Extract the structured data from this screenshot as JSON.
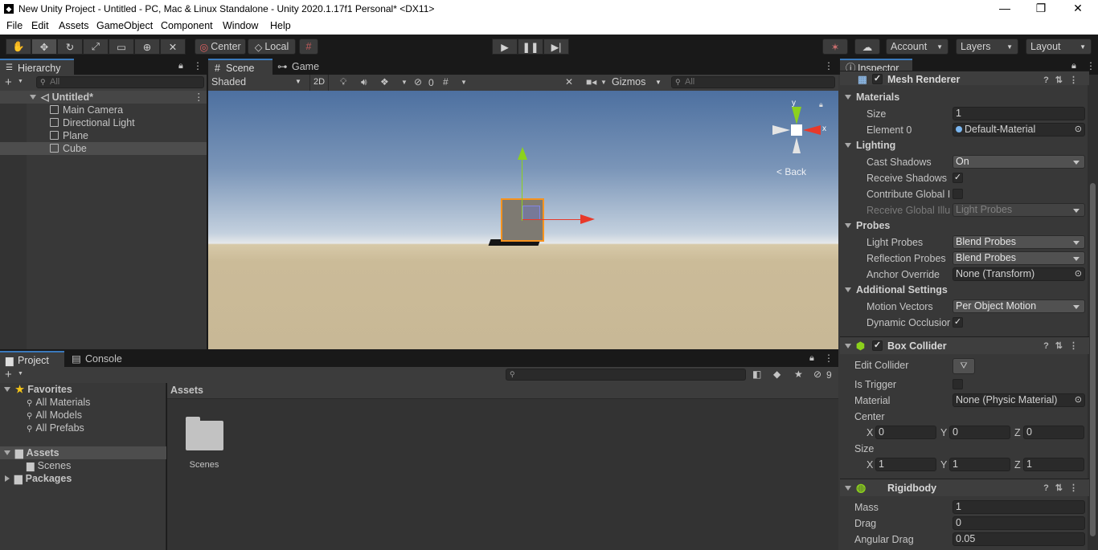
{
  "window": {
    "title": "New Unity Project - Untitled - PC, Mac & Linux Standalone - Unity 2020.1.17f1 Personal* <DX11>",
    "minimize": "—",
    "maximize": "❐",
    "close": "✕"
  },
  "menu": [
    "File",
    "Edit",
    "Assets",
    "GameObject",
    "Component",
    "Window",
    "Help"
  ],
  "toolbar": {
    "center": "Center",
    "local": "Local",
    "account": "Account",
    "layers": "Layers",
    "layout": "Layout"
  },
  "hierarchy": {
    "tab": "Hierarchy",
    "search_placeholder": "All",
    "scene": "Untitled*",
    "items": [
      "Main Camera",
      "Directional Light",
      "Plane",
      "Cube"
    ]
  },
  "scene_view": {
    "tabs": [
      "Scene",
      "Game"
    ],
    "shading": "Shaded",
    "mode2d": "2D",
    "hidden_count": "0",
    "gizmos": "Gizmos",
    "search_placeholder": "All",
    "gizmo_back": "Back",
    "gizmo_y": "y",
    "gizmo_x": "x"
  },
  "project": {
    "tabs": [
      "Project",
      "Console"
    ],
    "hidden_count": "9",
    "favorites_label": "Favorites",
    "favorites": [
      "All Materials",
      "All Models",
      "All Prefabs"
    ],
    "assets_label": "Assets",
    "asset_children": [
      "Scenes"
    ],
    "packages_label": "Packages",
    "breadcrumb": "Assets",
    "grid_items": [
      "Scenes"
    ]
  },
  "inspector": {
    "tab": "Inspector",
    "mesh_renderer": {
      "title": "Mesh Renderer",
      "materials": "Materials",
      "size_label": "Size",
      "size_value": "1",
      "element0_label": "Element 0",
      "element0_value": "Default-Material",
      "lighting": "Lighting",
      "cast_shadows_label": "Cast Shadows",
      "cast_shadows_value": "On",
      "receive_shadows_label": "Receive Shadows",
      "contribute_gi_label": "Contribute Global I",
      "receive_gi_label": "Receive Global Illu",
      "receive_gi_value": "Light Probes",
      "probes": "Probes",
      "light_probes_label": "Light Probes",
      "light_probes_value": "Blend Probes",
      "reflection_probes_label": "Reflection Probes",
      "reflection_probes_value": "Blend Probes",
      "anchor_override_label": "Anchor Override",
      "anchor_override_value": "None (Transform)",
      "additional": "Additional Settings",
      "motion_vectors_label": "Motion Vectors",
      "motion_vectors_value": "Per Object Motion",
      "dynamic_occlusion_label": "Dynamic Occlusior"
    },
    "box_collider": {
      "title": "Box Collider",
      "edit_collider_label": "Edit Collider",
      "is_trigger_label": "Is Trigger",
      "material_label": "Material",
      "material_value": "None (Physic Material)",
      "center_label": "Center",
      "center": {
        "x": "0",
        "y": "0",
        "z": "0"
      },
      "size_label": "Size",
      "size": {
        "x": "1",
        "y": "1",
        "z": "1"
      },
      "x": "X",
      "y": "Y",
      "z": "Z"
    },
    "rigidbody": {
      "title": "Rigidbody",
      "mass_label": "Mass",
      "mass_value": "1",
      "drag_label": "Drag",
      "drag_value": "0",
      "angular_drag_label": "Angular Drag",
      "angular_drag_value": "0.05"
    }
  },
  "colors": {
    "accent": "#3a79bb",
    "selection_orange": "#f7931e",
    "y_axis": "#8cd11c",
    "x_axis": "#e8392a"
  }
}
